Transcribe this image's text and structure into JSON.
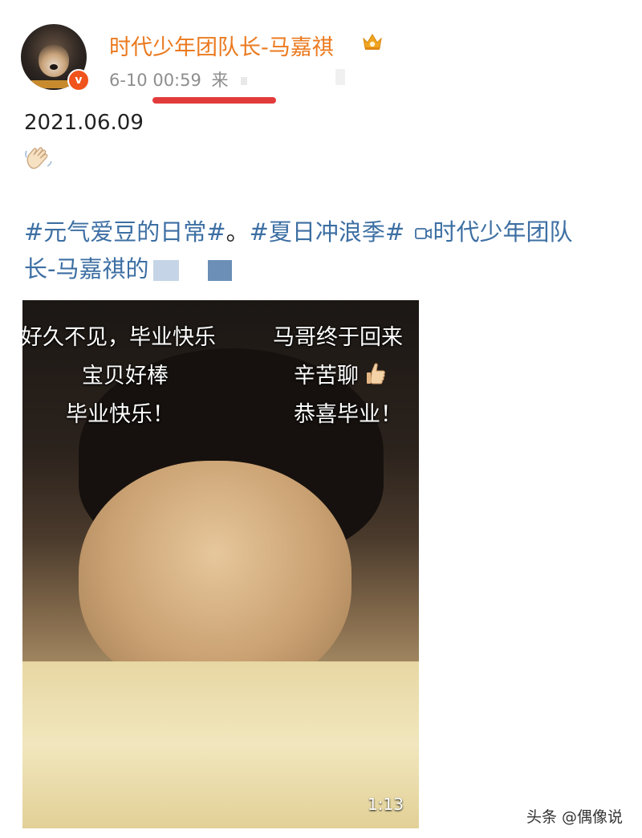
{
  "post": {
    "username": "时代少年团队长-马嘉祺",
    "meta_time": "6-10 00:59",
    "meta_source": "来",
    "verified_badge": "v",
    "date_line": "2021.06.09",
    "tags": {
      "tag1": "#元气爱豆的日常#",
      "sep": "。",
      "tag2": "#夏日冲浪季#",
      "video_prefix": "时代少年团队",
      "video_suffix": "长-马嘉祺的"
    }
  },
  "video": {
    "overlay_left": [
      "好久不见，毕业快乐",
      "宝贝好棒",
      "毕业快乐！"
    ],
    "overlay_right": [
      "马哥终于回来",
      "辛苦聊",
      "恭喜毕业！"
    ],
    "duration": "1:13"
  },
  "watermark": "头条 @偶像说",
  "colors": {
    "username": "#eb7a1f",
    "link": "#3d6fa3",
    "verified": "#f0531c",
    "underline": "#e23b3b"
  },
  "icons": [
    "crown-badge-icon",
    "verified-icon",
    "waving-hand-icon",
    "video-camera-icon",
    "thumbs-up-icon"
  ]
}
